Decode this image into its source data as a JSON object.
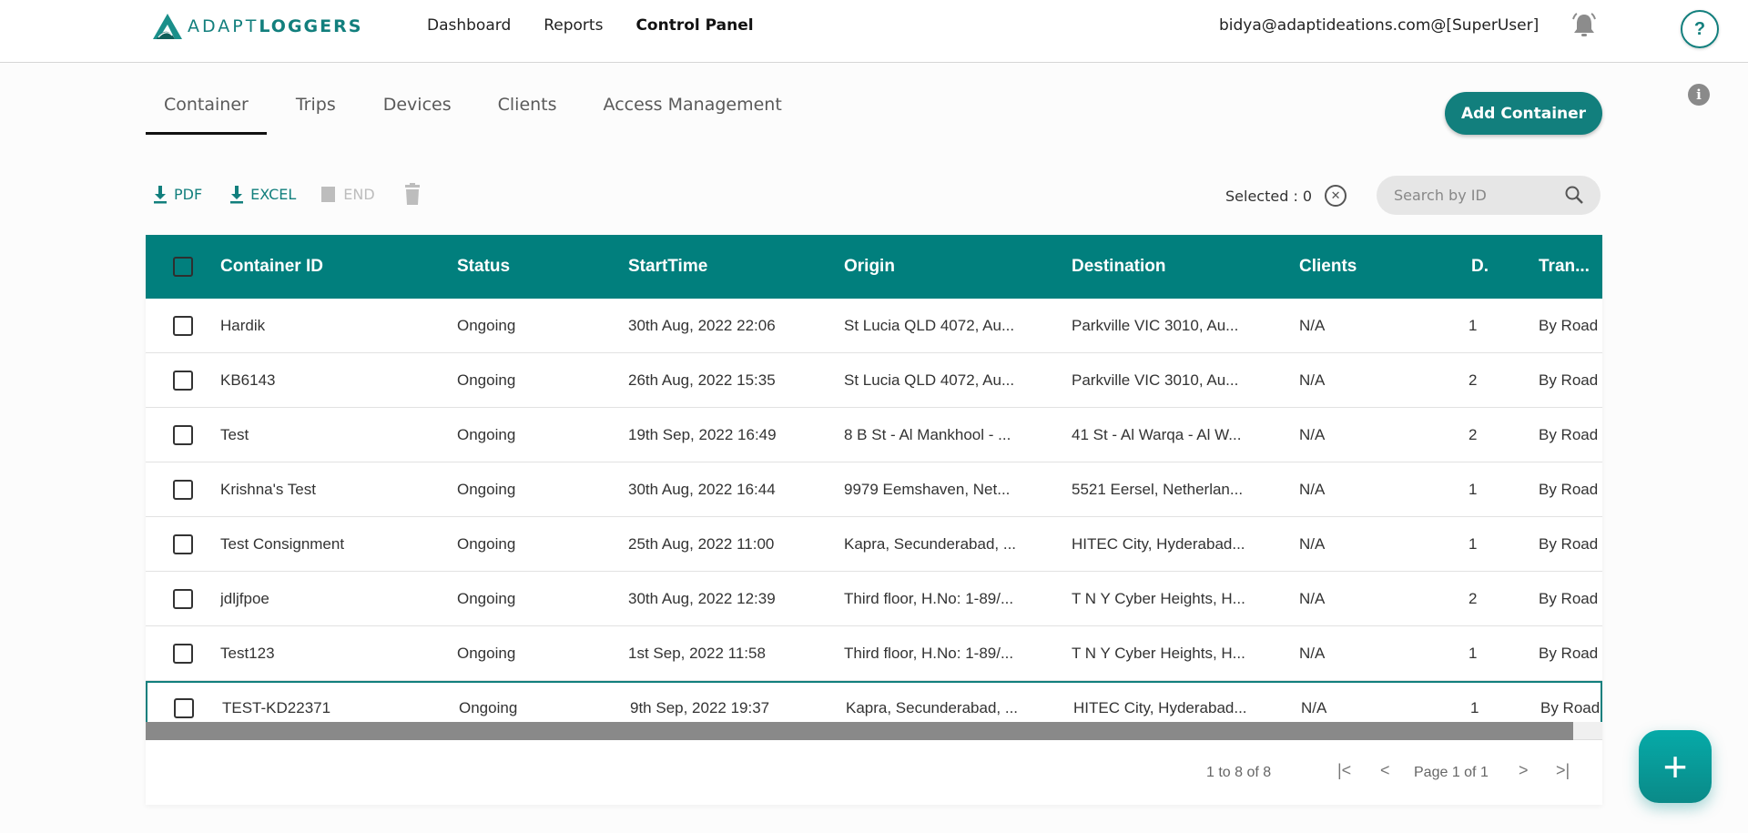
{
  "app": {
    "brand_light": "ADAPT",
    "brand_bold": "LOGGERS",
    "brand_color": "#127f7d"
  },
  "topnav": {
    "items": [
      {
        "label": "Dashboard",
        "active": false
      },
      {
        "label": "Reports",
        "active": false
      },
      {
        "label": "Control Panel",
        "active": true
      }
    ]
  },
  "user": {
    "label": "bidya@adaptideations.com@[SuperUser]"
  },
  "icons": {
    "bell": "bell-icon",
    "help": "?",
    "info": "i"
  },
  "tabs": [
    {
      "label": "Container",
      "active": true
    },
    {
      "label": "Trips",
      "active": false
    },
    {
      "label": "Devices",
      "active": false
    },
    {
      "label": "Clients",
      "active": false
    },
    {
      "label": "Access Management",
      "active": false
    }
  ],
  "actions": {
    "add_container": "Add Container",
    "pdf": "PDF",
    "excel": "EXCEL",
    "end": "END"
  },
  "selection": {
    "label": "Selected : 0"
  },
  "search": {
    "placeholder": "Search by ID",
    "value": ""
  },
  "table": {
    "header_color": "#017f7d",
    "columns": [
      "Container ID",
      "Status",
      "StartTime",
      "Origin",
      "Destination",
      "Clients",
      "D.",
      "Tran..."
    ],
    "rows": [
      {
        "id": "Hardik",
        "status": "Ongoing",
        "start": "30th Aug, 2022 22:06",
        "origin": "St Lucia QLD 4072, Au...",
        "destination": "Parkville VIC 3010, Au...",
        "clients": "N/A",
        "d": "1",
        "transport": "By Road"
      },
      {
        "id": "KB6143",
        "status": "Ongoing",
        "start": "26th Aug, 2022 15:35",
        "origin": "St Lucia QLD 4072, Au...",
        "destination": "Parkville VIC 3010, Au...",
        "clients": "N/A",
        "d": "2",
        "transport": "By Road"
      },
      {
        "id": "Test",
        "status": "Ongoing",
        "start": "19th Sep, 2022 16:49",
        "origin": "8 B St - Al Mankhool - ...",
        "destination": "41 St - Al Warqa - Al W...",
        "clients": "N/A",
        "d": "2",
        "transport": "By Road"
      },
      {
        "id": "Krishna's Test",
        "status": "Ongoing",
        "start": "30th Aug, 2022 16:44",
        "origin": "9979 Eemshaven, Net...",
        "destination": "5521 Eersel, Netherlan...",
        "clients": "N/A",
        "d": "1",
        "transport": "By Road"
      },
      {
        "id": "Test Consignment",
        "status": "Ongoing",
        "start": "25th Aug, 2022 11:00",
        "origin": "Kapra, Secunderabad, ...",
        "destination": "HITEC City, Hyderabad...",
        "clients": "N/A",
        "d": "1",
        "transport": "By Road"
      },
      {
        "id": "jdljfpoe",
        "status": "Ongoing",
        "start": "30th Aug, 2022 12:39",
        "origin": "Third floor, H.No: 1-89/...",
        "destination": "T N Y Cyber Heights, H...",
        "clients": "N/A",
        "d": "2",
        "transport": "By Road"
      },
      {
        "id": "Test123",
        "status": "Ongoing",
        "start": "1st Sep, 2022 11:58",
        "origin": "Third floor, H.No: 1-89/...",
        "destination": "T N Y Cyber Heights, H...",
        "clients": "N/A",
        "d": "1",
        "transport": "By Road"
      },
      {
        "id": "TEST-KD22371",
        "status": "Ongoing",
        "start": "9th Sep, 2022 19:37",
        "origin": "Kapra, Secunderabad, ...",
        "destination": "HITEC City, Hyderabad...",
        "clients": "N/A",
        "d": "1",
        "transport": "By Road"
      }
    ]
  },
  "scrollbar": {
    "horizontal_thumb_fraction": 0.98
  },
  "pagination": {
    "range": "1 to 8 of 8",
    "page_label": "Page 1 of 1",
    "first": "|<",
    "prev": "<",
    "next": ">",
    "last": ">|"
  },
  "fab": {
    "label": "+"
  }
}
